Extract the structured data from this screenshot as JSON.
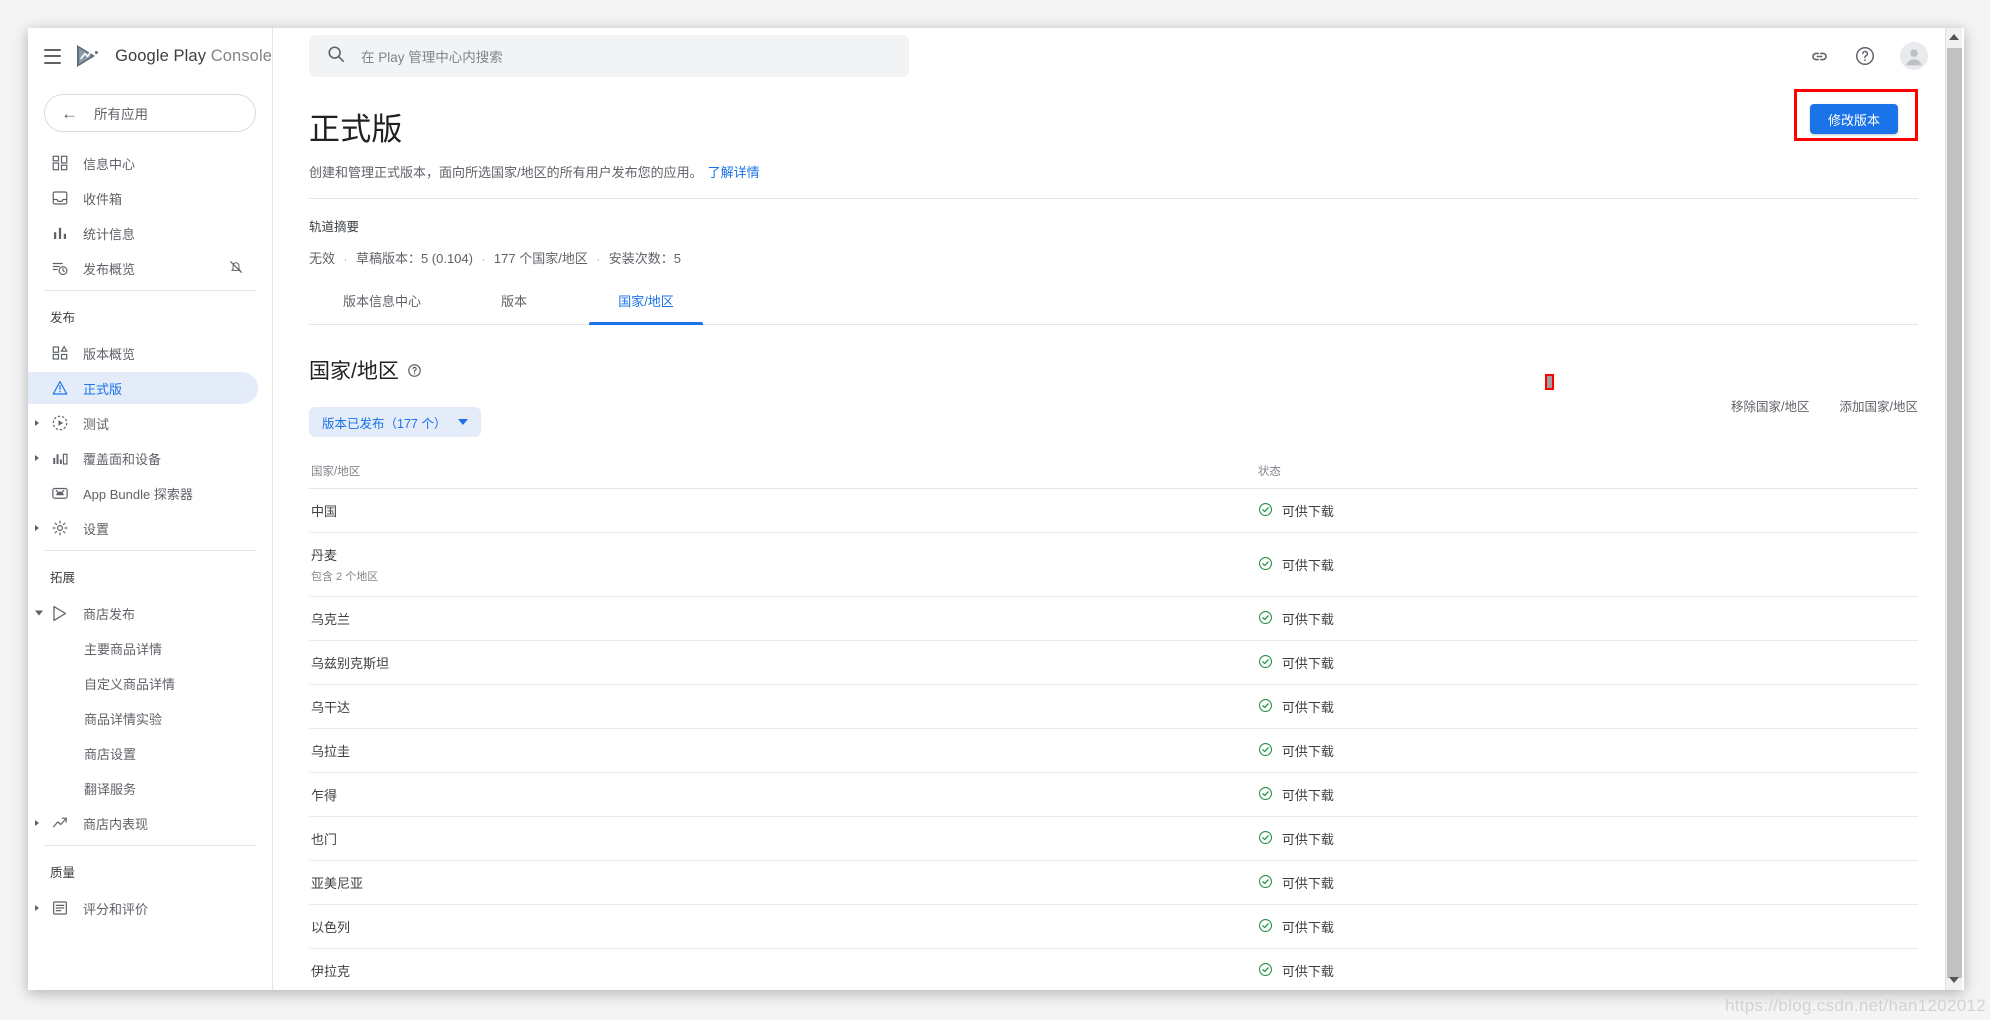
{
  "brand": {
    "name_google_play": "Google Play",
    "name_console": "Console",
    "menu_icon": "hamburger-icon",
    "logo_icon": "google-play-logo-icon"
  },
  "sidebar": {
    "all_apps_label": "所有应用",
    "groups": [
      {
        "title": null,
        "items": [
          {
            "label": "信息中心",
            "icon": "dashboard-icon",
            "active": false,
            "caret": null,
            "sub": false,
            "trailing_icon": null
          },
          {
            "label": "收件箱",
            "icon": "inbox-icon",
            "active": false,
            "caret": null,
            "sub": false,
            "trailing_icon": null
          },
          {
            "label": "统计信息",
            "icon": "bar-chart-icon",
            "active": false,
            "caret": null,
            "sub": false,
            "trailing_icon": null
          },
          {
            "label": "发布概览",
            "icon": "release-overview-icon",
            "active": false,
            "caret": null,
            "sub": false,
            "trailing_icon": "notifications-off-icon"
          }
        ]
      },
      {
        "title": "发布",
        "items": [
          {
            "label": "版本概览",
            "icon": "release-dashboard-icon",
            "active": false,
            "caret": null,
            "sub": false,
            "trailing_icon": null
          },
          {
            "label": "正式版",
            "icon": "production-icon",
            "active": true,
            "caret": null,
            "sub": false,
            "trailing_icon": null
          },
          {
            "label": "测试",
            "icon": "testing-icon",
            "active": false,
            "caret": "closed",
            "sub": false,
            "trailing_icon": null
          },
          {
            "label": "覆盖面和设备",
            "icon": "reach-devices-icon",
            "active": false,
            "caret": "closed",
            "sub": false,
            "trailing_icon": null
          },
          {
            "label": "App Bundle 探索器",
            "icon": "app-bundle-icon",
            "active": false,
            "caret": null,
            "sub": false,
            "trailing_icon": null
          },
          {
            "label": "设置",
            "icon": "gear-icon",
            "active": false,
            "caret": "closed",
            "sub": false,
            "trailing_icon": null
          }
        ]
      },
      {
        "title": "拓展",
        "items": [
          {
            "label": "商店发布",
            "icon": "store-presence-icon",
            "active": false,
            "caret": "open",
            "sub": false,
            "trailing_icon": null
          },
          {
            "label": "主要商品详情",
            "icon": null,
            "active": false,
            "caret": null,
            "sub": true,
            "trailing_icon": null
          },
          {
            "label": "自定义商品详情",
            "icon": null,
            "active": false,
            "caret": null,
            "sub": true,
            "trailing_icon": null
          },
          {
            "label": "商品详情实验",
            "icon": null,
            "active": false,
            "caret": null,
            "sub": true,
            "trailing_icon": null
          },
          {
            "label": "商店设置",
            "icon": null,
            "active": false,
            "caret": null,
            "sub": true,
            "trailing_icon": null
          },
          {
            "label": "翻译服务",
            "icon": null,
            "active": false,
            "caret": null,
            "sub": true,
            "trailing_icon": null
          },
          {
            "label": "商店内表现",
            "icon": "trending-up-icon",
            "active": false,
            "caret": "closed",
            "sub": false,
            "trailing_icon": null
          }
        ]
      },
      {
        "title": "质量",
        "items": [
          {
            "label": "评分和评价",
            "icon": "reviews-icon",
            "active": false,
            "caret": "closed",
            "sub": false,
            "trailing_icon": null
          }
        ]
      }
    ]
  },
  "topbar": {
    "search_placeholder": "在 Play 管理中心内搜索",
    "search_icon": "search-icon",
    "link_icon": "link-icon",
    "help_icon": "help-circle-icon",
    "avatar_icon": "account-avatar-icon"
  },
  "header": {
    "title": "正式版",
    "description": "创建和管理正式版本，面向所选国家/地区的所有用户发布您的应用。",
    "learn_more": "了解详情",
    "cta_label": "修改版本"
  },
  "summary": {
    "title": "轨道摘要",
    "status": "无效",
    "draft_version": "草稿版本：5 (0.104)",
    "countries": "177 个国家/地区",
    "installs": "安装次数：5",
    "separator": "·"
  },
  "tabs": [
    {
      "label": "版本信息中心",
      "active": false
    },
    {
      "label": "版本",
      "active": false
    },
    {
      "label": "国家/地区",
      "active": true
    }
  ],
  "section": {
    "heading": "国家/地区",
    "help_icon": "help-circle-icon",
    "filter_chip": "版本已发布（177 个）",
    "remove_action": "移除国家/地区",
    "add_action": "添加国家/地区"
  },
  "table": {
    "columns": [
      "国家/地区",
      "状态"
    ],
    "status_icon": "check-circle-icon",
    "status_color": "#1e8e3e",
    "rows": [
      {
        "country": "中国",
        "note": null,
        "status": "可供下载"
      },
      {
        "country": "丹麦",
        "note": "包含 2 个地区",
        "status": "可供下载"
      },
      {
        "country": "乌克兰",
        "note": null,
        "status": "可供下载"
      },
      {
        "country": "乌兹别克斯坦",
        "note": null,
        "status": "可供下载"
      },
      {
        "country": "乌干达",
        "note": null,
        "status": "可供下载"
      },
      {
        "country": "乌拉圭",
        "note": null,
        "status": "可供下载"
      },
      {
        "country": "乍得",
        "note": null,
        "status": "可供下载"
      },
      {
        "country": "也门",
        "note": null,
        "status": "可供下载"
      },
      {
        "country": "亚美尼亚",
        "note": null,
        "status": "可供下载"
      },
      {
        "country": "以色列",
        "note": null,
        "status": "可供下载"
      },
      {
        "country": "伊拉克",
        "note": null,
        "status": "可供下载"
      }
    ]
  },
  "annotations": {
    "cta_highlight_color": "#ff0000",
    "marker_color": "#ff0000"
  },
  "watermark": "https://blog.csdn.net/han1202012"
}
